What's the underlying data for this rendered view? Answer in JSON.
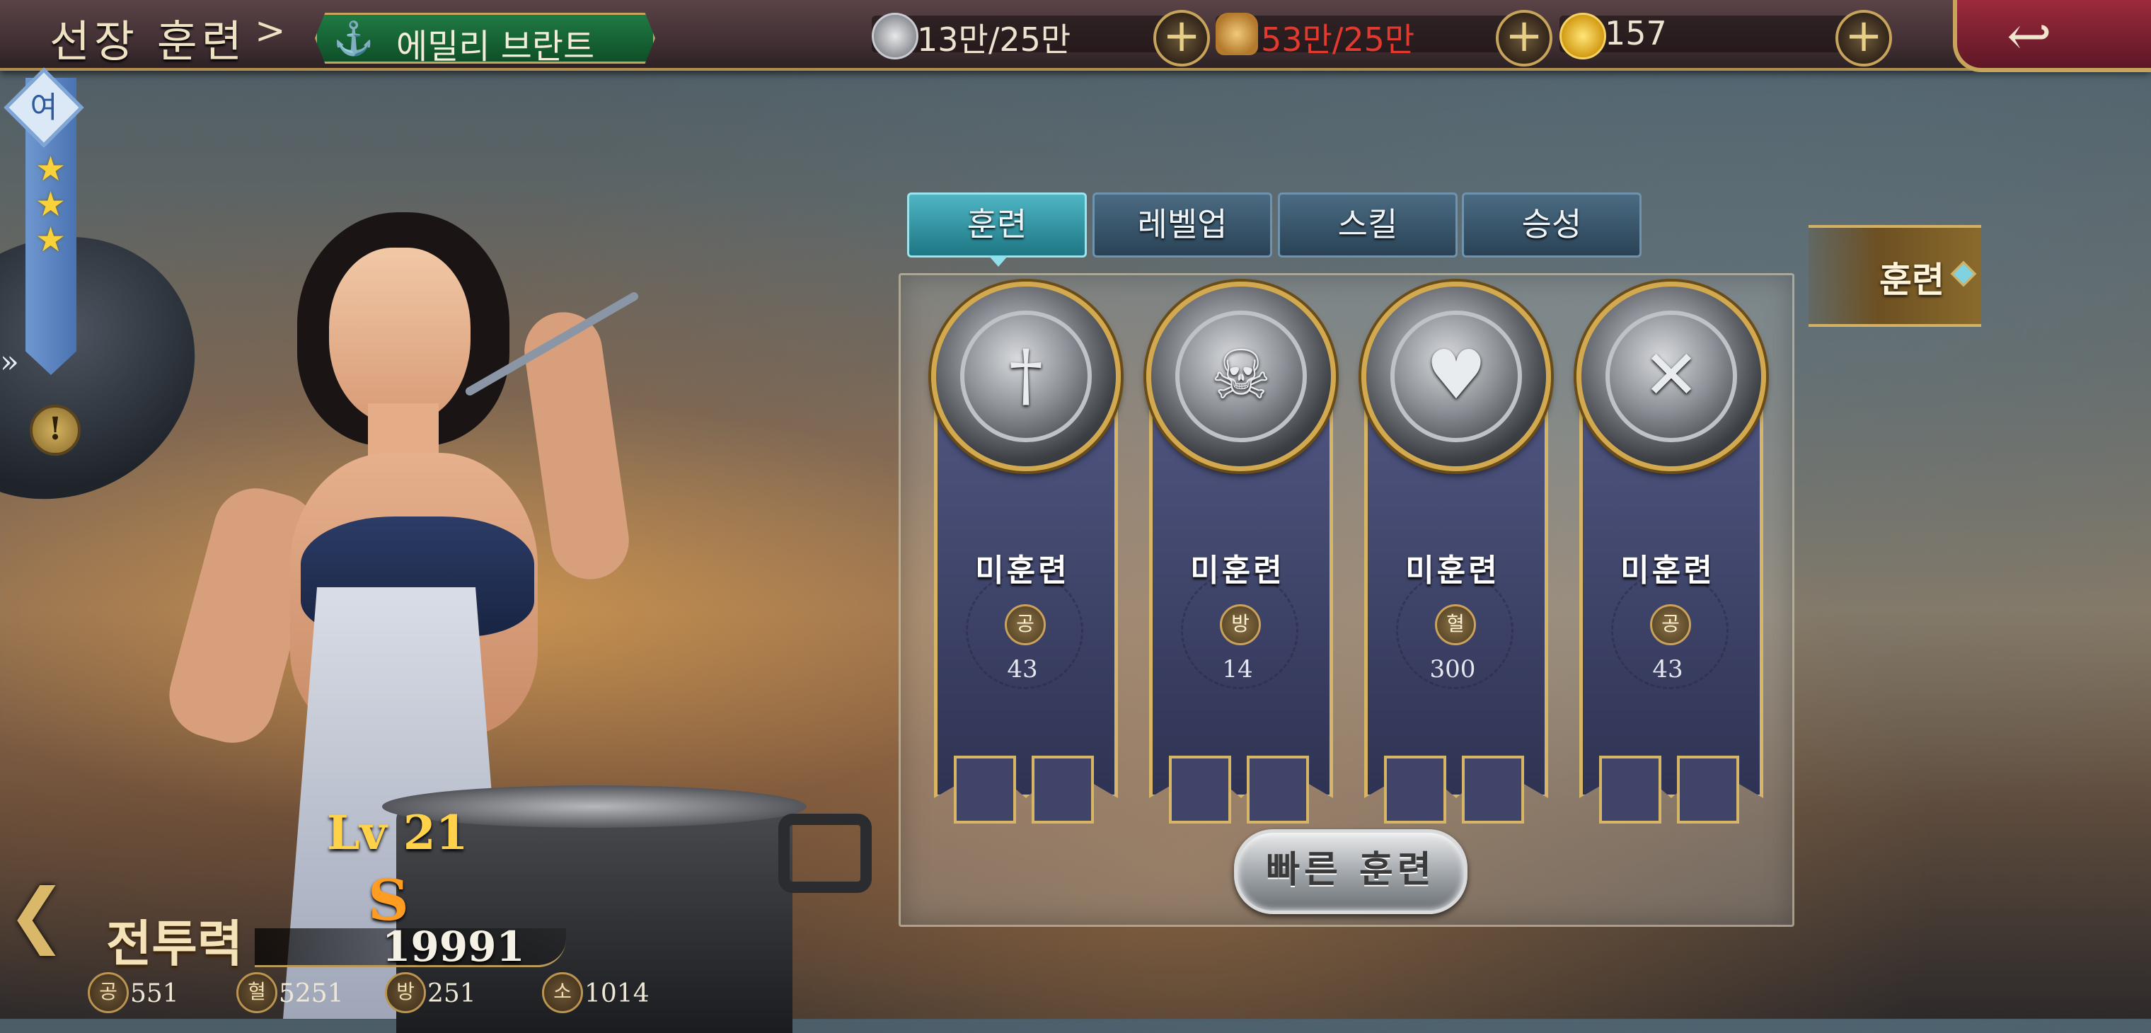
{
  "header": {
    "title": "선장 훈련",
    "crumb_arrow": ">",
    "captain_name": "에밀리 브란트",
    "captain_emblem": "anchor-wings-icon",
    "resources": [
      {
        "icon": "silver-coin-icon",
        "value": "13만/25만",
        "color": "#ece4d0"
      },
      {
        "icon": "bread-icon",
        "value": "53만/25만",
        "color": "#e23a2e"
      },
      {
        "icon": "gold-coin-icon",
        "value": "157",
        "color": "#ece4d0"
      }
    ],
    "plus": "+",
    "back_glyph": "↩"
  },
  "hero": {
    "gender": "여",
    "stars": 3,
    "star_glyph": "★",
    "expand_glyph": "»",
    "warn_glyph": "!",
    "level": "Lv 21",
    "grade": "S",
    "combat_label": "전투력",
    "combat_power": "19991",
    "back_glyph": "❮",
    "stats": [
      {
        "label": "공",
        "value": "551"
      },
      {
        "label": "혈",
        "value": "5251"
      },
      {
        "label": "방",
        "value": "251"
      },
      {
        "label": "소",
        "value": "1014"
      }
    ]
  },
  "tabs": [
    {
      "label": "훈련",
      "active": true
    },
    {
      "label": "레벨업",
      "active": false
    },
    {
      "label": "스킬",
      "active": false
    },
    {
      "label": "승성",
      "active": false
    }
  ],
  "side_tab": {
    "label": "훈련"
  },
  "cards": [
    {
      "emblem": "sword-crest-icon",
      "glyph": "†",
      "status": "미훈련",
      "stat": "공",
      "value": "43"
    },
    {
      "emblem": "skull-crest-icon",
      "glyph": "☠",
      "status": "미훈련",
      "stat": "방",
      "value": "14"
    },
    {
      "emblem": "heart-crest-icon",
      "glyph": "♥",
      "status": "미훈련",
      "stat": "혈",
      "value": "300"
    },
    {
      "emblem": "crossed-guns-icon",
      "glyph": "✕",
      "status": "미훈련",
      "stat": "공",
      "value": "43"
    }
  ],
  "quick_train": "빠른 훈련"
}
